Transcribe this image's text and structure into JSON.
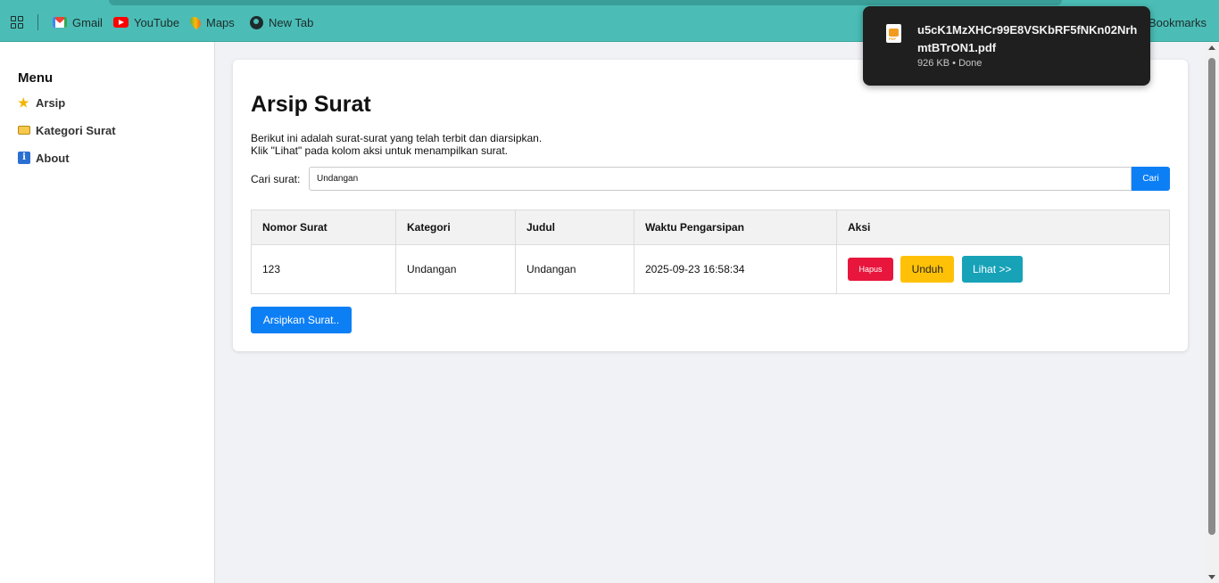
{
  "bookmarks": {
    "items": [
      {
        "label": "Gmail",
        "icon": "gmail-icon"
      },
      {
        "label": "YouTube",
        "icon": "youtube-icon"
      },
      {
        "label": "Maps",
        "icon": "maps-icon"
      },
      {
        "label": "New Tab",
        "icon": "globe-icon"
      }
    ],
    "all_bookmarks_label": "Bookmarks"
  },
  "download": {
    "filename": "u5cK1MzXHCr99E8VSKbRF5fNKn02NrhmtBTrON1.pdf",
    "size": "926 KB",
    "separator": "•",
    "status": "Done"
  },
  "sidebar": {
    "title": "Menu",
    "items": [
      {
        "label": "Arsip",
        "icon": "star-icon"
      },
      {
        "label": "Kategori Surat",
        "icon": "folder-icon"
      },
      {
        "label": "About",
        "icon": "info-icon"
      }
    ]
  },
  "main": {
    "title": "Arsip Surat",
    "description_line1": "Berikut ini adalah surat-surat yang telah terbit dan diarsipkan.",
    "description_line2": "Klik \"Lihat\" pada kolom aksi untuk menampilkan surat.",
    "search": {
      "label": "Cari surat:",
      "value": "Undangan",
      "button_label": "Cari"
    },
    "table": {
      "headers": [
        "Nomor Surat",
        "Kategori",
        "Judul",
        "Waktu Pengarsipan",
        "Aksi"
      ],
      "rows": [
        {
          "nomor": "123",
          "kategori": "Undangan",
          "judul": "Undangan",
          "waktu": "2025-09-23 16:58:34",
          "actions": {
            "hapus": "Hapus",
            "unduh": "Unduh",
            "lihat": "Lihat >>"
          }
        }
      ]
    },
    "archive_button_label": "Arsipkan Surat.."
  },
  "colors": {
    "bookmarks_bar": "#4bbdb6",
    "primary": "#0d7ff5",
    "danger": "#e8163c",
    "warning": "#ffc107",
    "info": "#17a2b8"
  }
}
